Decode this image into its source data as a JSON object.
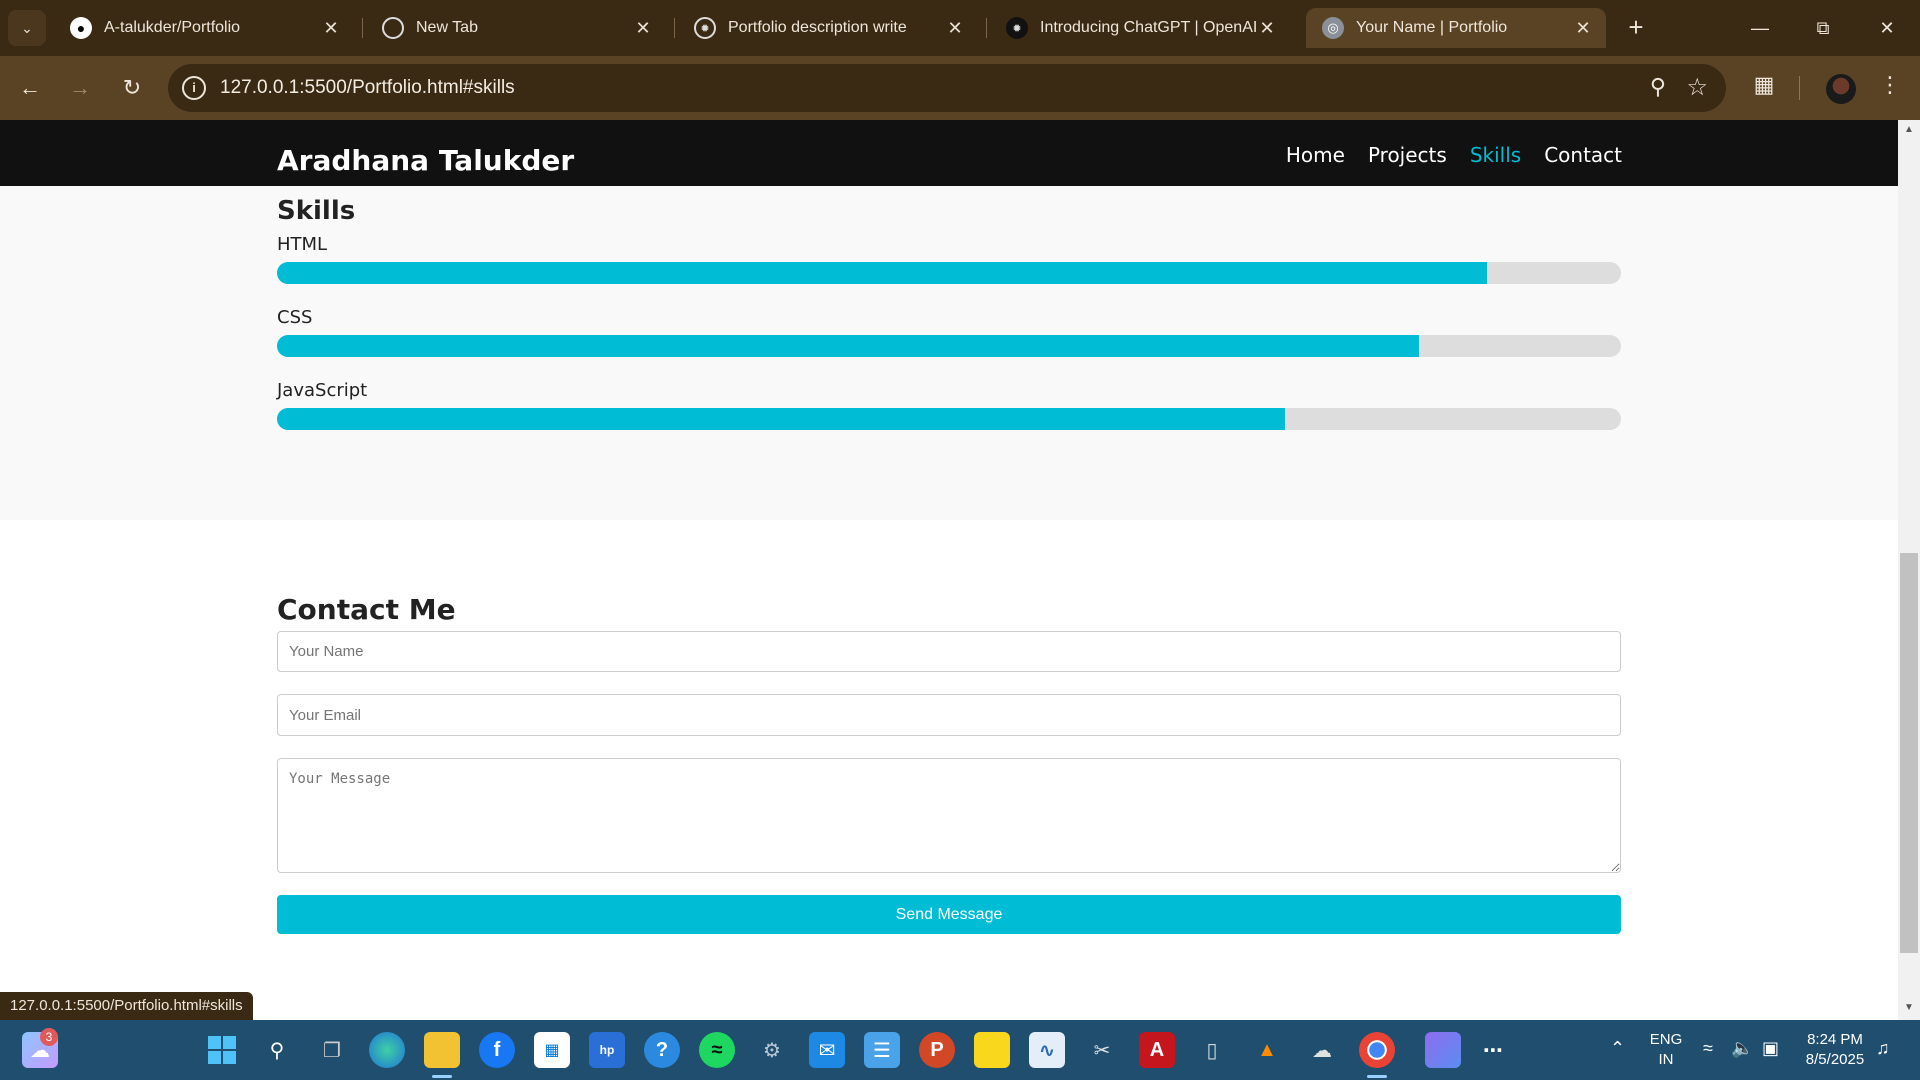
{
  "browser": {
    "tabs": [
      {
        "title": "A-talukder/Portfolio",
        "icon": "github-icon"
      },
      {
        "title": "New Tab",
        "icon": "chrome-icon"
      },
      {
        "title": "Portfolio description write",
        "icon": "openai-icon"
      },
      {
        "title": "Introducing ChatGPT | OpenAI",
        "icon": "openai-icon"
      },
      {
        "title": "Your Name | Portfolio",
        "icon": "globe-icon",
        "active": true
      }
    ],
    "url": "127.0.0.1:5500/Portfolio.html#skills",
    "status_url": "127.0.0.1:5500/Portfolio.html#skills"
  },
  "site": {
    "brand": "Aradhana Talukder",
    "nav": [
      {
        "label": "Home"
      },
      {
        "label": "Projects"
      },
      {
        "label": "Skills",
        "active": true
      },
      {
        "label": "Contact"
      }
    ]
  },
  "skills": {
    "title": "Skills",
    "items": [
      {
        "label": "HTML",
        "level_percent": 90
      },
      {
        "label": "CSS",
        "level_percent": 85
      },
      {
        "label": "JavaScript",
        "level_percent": 75
      }
    ]
  },
  "contact": {
    "title": "Contact Me",
    "name_placeholder": "Your Name",
    "email_placeholder": "Your Email",
    "message_placeholder": "Your Message",
    "submit_label": "Send Message"
  },
  "taskbar": {
    "weather_badge": "3",
    "language": "ENG",
    "region": "IN",
    "time": "8:24 PM",
    "date": "8/5/2025"
  },
  "colors": {
    "accent": "#00bcd4",
    "header_bg": "#111111",
    "chrome_tab_bar": "#3a2a14",
    "chrome_toolbar": "#5a4324",
    "taskbar": "#1f4e6e"
  }
}
